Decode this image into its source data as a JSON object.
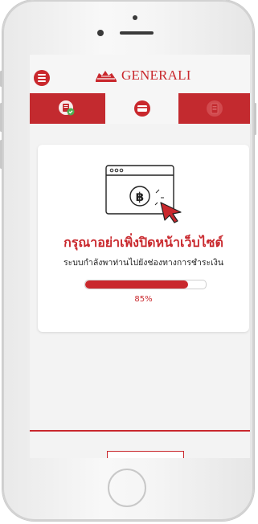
{
  "app": {
    "brand": "GENERALI",
    "brand_color": "#c9282d"
  },
  "header": {
    "menu_icon": "hamburger-menu-icon",
    "logo_icon": "generali-lion-icon"
  },
  "steps": [
    {
      "icon": "document-check-icon",
      "state": "done"
    },
    {
      "icon": "payment-card-icon",
      "state": "active"
    },
    {
      "icon": "receipt-icon",
      "state": "upcoming"
    }
  ],
  "status_card": {
    "illustration_icon": "browser-baht-cursor-icon",
    "title": "กรุณาอย่าเพิ่งปิดหน้าเว็บไซต์",
    "subtitle": "ระบบกำลังพาท่านไปยังช่องทางการชำระเงิน",
    "progress_percent": 85,
    "progress_label": "85%"
  }
}
